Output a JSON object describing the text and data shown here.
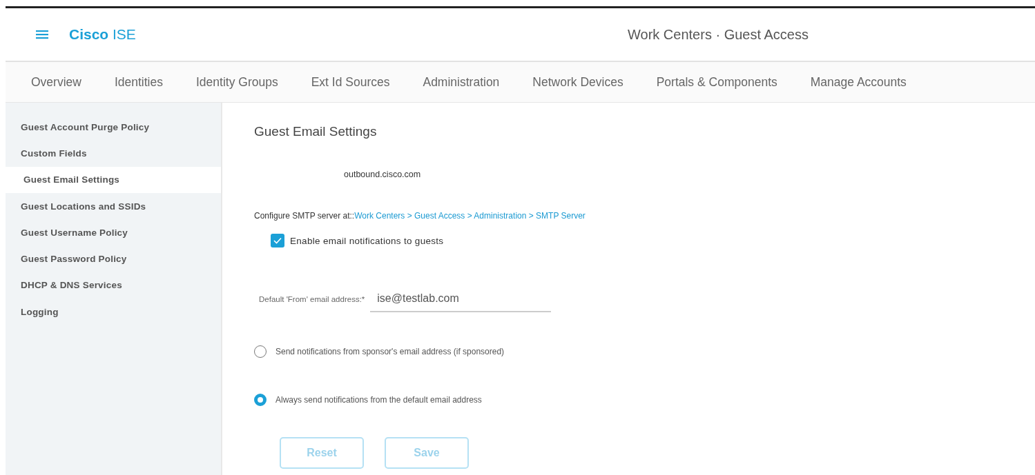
{
  "header": {
    "brand_bold": "Cisco",
    "brand_light": "ISE",
    "title": "Work Centers · Guest Access"
  },
  "tabs": [
    {
      "label": "Overview",
      "selected": false
    },
    {
      "label": "Identities",
      "selected": false
    },
    {
      "label": "Identity Groups",
      "selected": false
    },
    {
      "label": "Ext Id Sources",
      "selected": false
    },
    {
      "label": "Administration",
      "selected": false
    },
    {
      "label": "Network Devices",
      "selected": false
    },
    {
      "label": "Portals & Components",
      "selected": false
    },
    {
      "label": "Manage Accounts",
      "selected": false
    }
  ],
  "sidebar": {
    "items": [
      {
        "label": "Guest Account Purge Policy",
        "selected": false
      },
      {
        "label": "Custom Fields",
        "selected": false
      },
      {
        "label": "Guest Email Settings",
        "selected": true
      },
      {
        "label": "Guest Locations and SSIDs",
        "selected": false
      },
      {
        "label": "Guest Username Policy",
        "selected": false
      },
      {
        "label": "Guest Password Policy",
        "selected": false
      },
      {
        "label": "DHCP & DNS Services",
        "selected": false
      },
      {
        "label": "Logging",
        "selected": false
      }
    ]
  },
  "content": {
    "title": "Guest Email Settings",
    "smtp_host": "outbound.cisco.com",
    "configure_text": "Configure SMTP server at::",
    "configure_link": "Work Centers > Guest Access > Administration > SMTP Server",
    "enable_notifications": {
      "label": "Enable email notifications to guests",
      "checked": true
    },
    "from_field": {
      "label": "Default 'From' email address:*",
      "value": "ise@testlab.com"
    },
    "sender_options": [
      {
        "label": "Send notifications from sponsor's email address (if sponsored)",
        "selected": false
      },
      {
        "label": "Always send notifications from the default email address",
        "selected": true
      }
    ],
    "buttons": [
      "Reset",
      "Save"
    ]
  }
}
